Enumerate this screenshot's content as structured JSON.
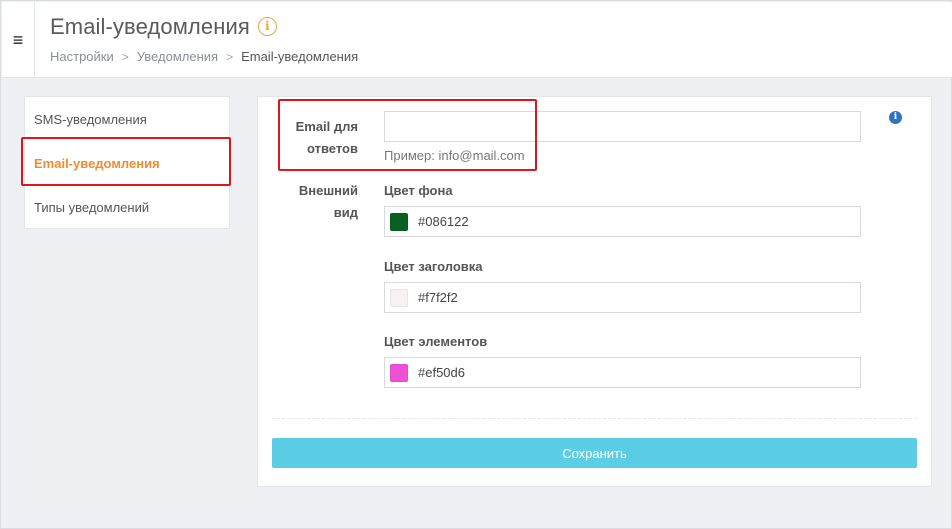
{
  "header": {
    "menu_icon": "hamburger-icon",
    "title": "Email-уведомления",
    "title_info_icon": "info-icon",
    "breadcrumb": [
      "Настройки",
      "Уведомления",
      "Email-уведомления"
    ],
    "breadcrumb_separator": ">"
  },
  "sidebar": {
    "items": [
      {
        "label": "SMS-уведомления",
        "active": false
      },
      {
        "label": "Email-уведомления",
        "active": true
      },
      {
        "label": "Типы уведомлений",
        "active": false
      }
    ]
  },
  "form": {
    "reply_email": {
      "label_line1": "Email для",
      "label_line2": "ответов",
      "value": "",
      "hint": "Пример: info@mail.com",
      "info_icon": "info-icon"
    },
    "appearance": {
      "label_line1": "Внешний",
      "label_line2": "вид",
      "background": {
        "label": "Цвет фона",
        "value": "#086122"
      },
      "header": {
        "label": "Цвет заголовка",
        "value": "#f7f2f2"
      },
      "elements": {
        "label": "Цвет элементов",
        "value": "#ef50d6"
      }
    },
    "save_label": "Сохранить"
  },
  "colors": {
    "accent_orange": "#f28b30",
    "highlight_red": "#e0141b",
    "button_cyan": "#5bcde5",
    "info_blue": "#2f74c0"
  }
}
